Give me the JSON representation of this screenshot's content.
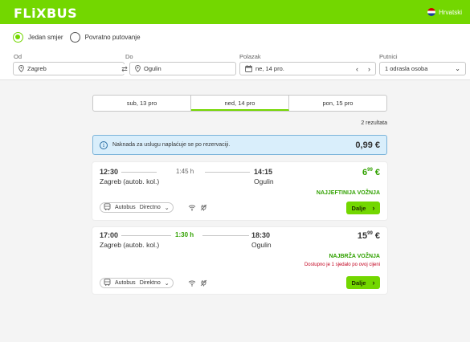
{
  "header": {
    "logo": "FLiXBUS",
    "language": "Hrvatski"
  },
  "trip_type": {
    "one_way": "Jedan smjer",
    "round_trip": "Povratno putovanje",
    "selected": "one_way"
  },
  "search": {
    "from_label": "Od",
    "from_value": "Zagreb",
    "to_label": "Do",
    "to_value": "Ogulin",
    "date_label": "Polazak",
    "date_value": "ne, 14 pro.",
    "passengers_label": "Putnici",
    "passengers_value": "1 odrasla osoba"
  },
  "date_tabs": [
    {
      "label": "sub, 13 pro"
    },
    {
      "label": "ned, 14 pro",
      "active": true
    },
    {
      "label": "pon, 15 pro"
    }
  ],
  "results_count": "2 rezultata",
  "notice": {
    "text": "Naknada za uslugu naplaćuje se po rezervaciji.",
    "fee": "0,99 €"
  },
  "results": [
    {
      "dep_time": "12:30",
      "duration": "1:45 h",
      "arr_time": "14:15",
      "from": "Zagreb (autob. kol.)",
      "to": "Ogulin",
      "price_main": "6",
      "price_cents": "99",
      "currency": "€",
      "tag": "NAJJEFTINIJA VOŽNJA",
      "transport": "Autobus",
      "route_type": "Directno",
      "button": "Dalje"
    },
    {
      "dep_time": "17:00",
      "duration": "1:30 h",
      "arr_time": "18:30",
      "from": "Zagreb (autob. kol.)",
      "to": "Ogulin",
      "price_main": "15",
      "price_cents": "99",
      "currency": "€",
      "tag": "NAJBRŽA VOŽNJA",
      "availability": "Dostupno je 1 sjedalo po ovoj cijeni",
      "transport": "Autobus",
      "route_type": "Direktno",
      "button": "Dalje"
    }
  ],
  "colors": {
    "brand": "#73d700",
    "success": "#31a100",
    "danger": "#c2001e",
    "info_bg": "#d9eefb"
  }
}
